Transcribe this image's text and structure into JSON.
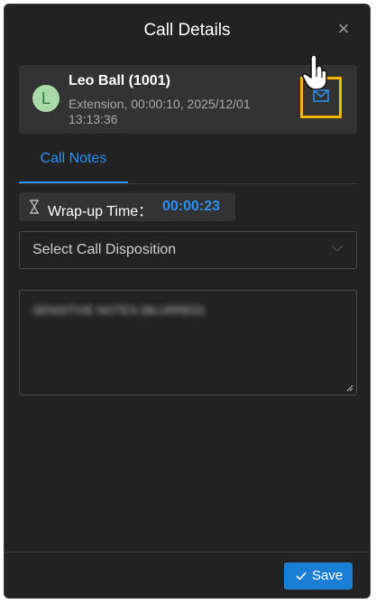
{
  "dialog": {
    "title": "Call Details",
    "close_glyph": "×"
  },
  "contact": {
    "avatar_initial": "L",
    "name": "Leo Ball (1001)",
    "details": "Extension, 00:00:10, 2025/12/01 13:13:36",
    "mail_icon": "mail-icon",
    "highlight_color": "#f5b400"
  },
  "tabs": [
    {
      "label": "Call Notes",
      "active": true
    }
  ],
  "wrapup": {
    "label": "Wrap-up Time：",
    "value": "00:00:23",
    "icon": "hourglass-icon"
  },
  "disposition": {
    "placeholder": "Select Call Disposition"
  },
  "notes": {
    "value": "SENSITIVE NOTES (BLURRED)"
  },
  "footer": {
    "save_label": "Save"
  },
  "colors": {
    "accent": "#2e8ef0",
    "panel_bg": "#222222",
    "save_button": "#1a7fd4"
  }
}
